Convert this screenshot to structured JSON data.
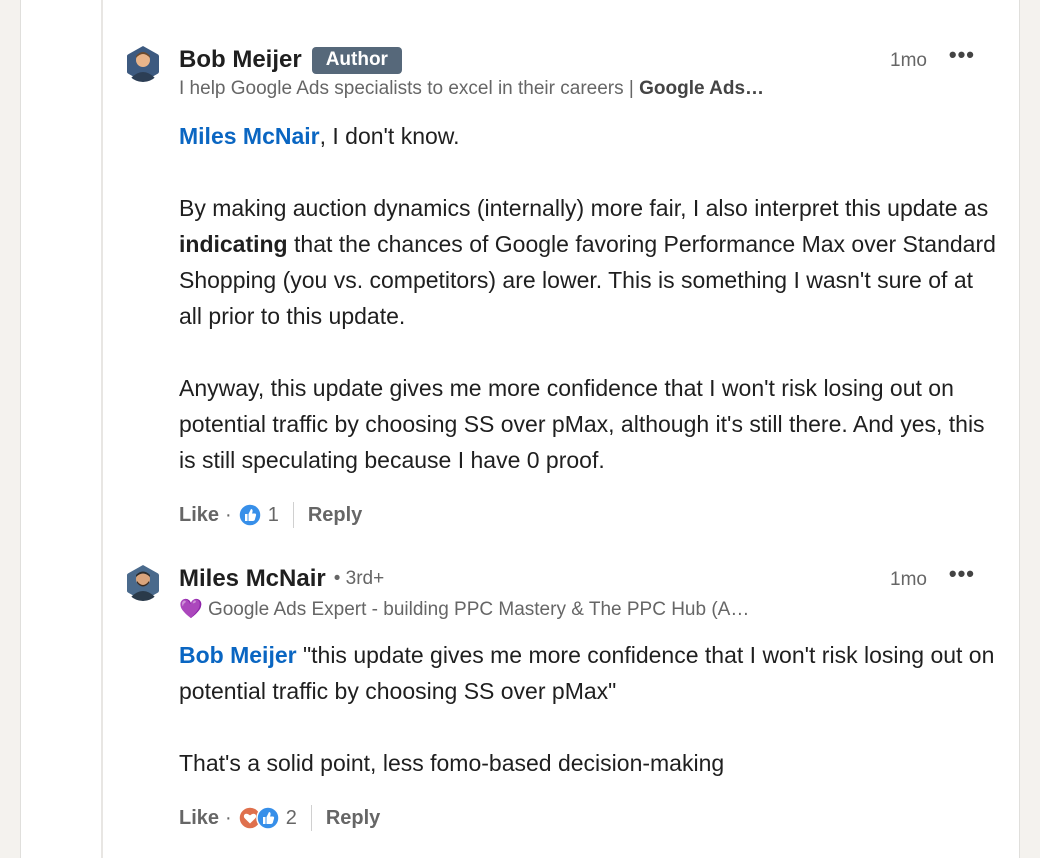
{
  "comments": [
    {
      "author": "Bob Meijer",
      "badge": "Author",
      "headline_text": "I help Google Ads specialists to excel in their careers | ",
      "headline_bold": "Google Ads…",
      "time": "1mo",
      "more": "•••",
      "mention": "Miles McNair",
      "p1_rest": ", I don't know.",
      "p2_a": "By making auction dynamics (internally) more fair, I also interpret this update as ",
      "p2_bold": "indicating",
      "p2_b": " that the chances of Google favoring Performance Max over Standard Shopping (you vs. competitors) are lower. This is something I wasn't sure of at all prior to this update.",
      "p3": "Anyway, this update gives me more confidence that I won't risk losing out on potential traffic by choosing SS over pMax, although it's still there. And yes, this is still speculating because I have 0 proof.",
      "like": "Like",
      "dot": "·",
      "reactions_count": "1",
      "reply": "Reply"
    },
    {
      "author": "Miles McNair",
      "degree": "• 3rd+",
      "headline_emoji": "💜",
      "headline_text": " Google Ads Expert - building PPC Mastery & The PPC Hub (A…",
      "time": "1mo",
      "more": "•••",
      "mention": "Bob Meijer",
      "p1_rest": " \"this update gives me more confidence that I won't risk losing out on potential traffic by choosing SS over pMax\"",
      "p2": "That's a solid point, less fomo-based decision-making",
      "like": "Like",
      "dot": "·",
      "reactions_count": "2",
      "reply": "Reply"
    }
  ],
  "colors": {
    "link": "#0a66c2",
    "badge": "#56687a",
    "like_blue": "#378fe9",
    "love_red": "#df704d"
  },
  "icons": {
    "like": "thumbs-up-icon",
    "love": "heart-icon",
    "more": "more-icon"
  }
}
